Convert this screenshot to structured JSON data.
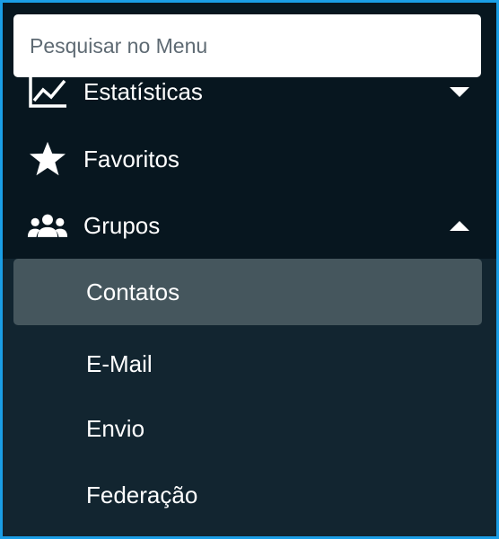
{
  "search": {
    "placeholder": "Pesquisar no Menu"
  },
  "menu": {
    "items": [
      {
        "label": "Estatísticas",
        "icon": "chart-line-icon",
        "caret": "down"
      },
      {
        "label": "Favoritos",
        "icon": "star-icon"
      },
      {
        "label": "Grupos",
        "icon": "users-icon",
        "caret": "up"
      }
    ],
    "submenu": [
      {
        "label": "Contatos",
        "active": true
      },
      {
        "label": "E-Mail"
      },
      {
        "label": "Envio"
      },
      {
        "label": "Federação"
      }
    ]
  },
  "colors": {
    "border": "#1a9ee6",
    "dark_bg": "#07161f",
    "submenu_bg": "#122530",
    "active_bg": "#45565d",
    "text": "#ffffff"
  }
}
